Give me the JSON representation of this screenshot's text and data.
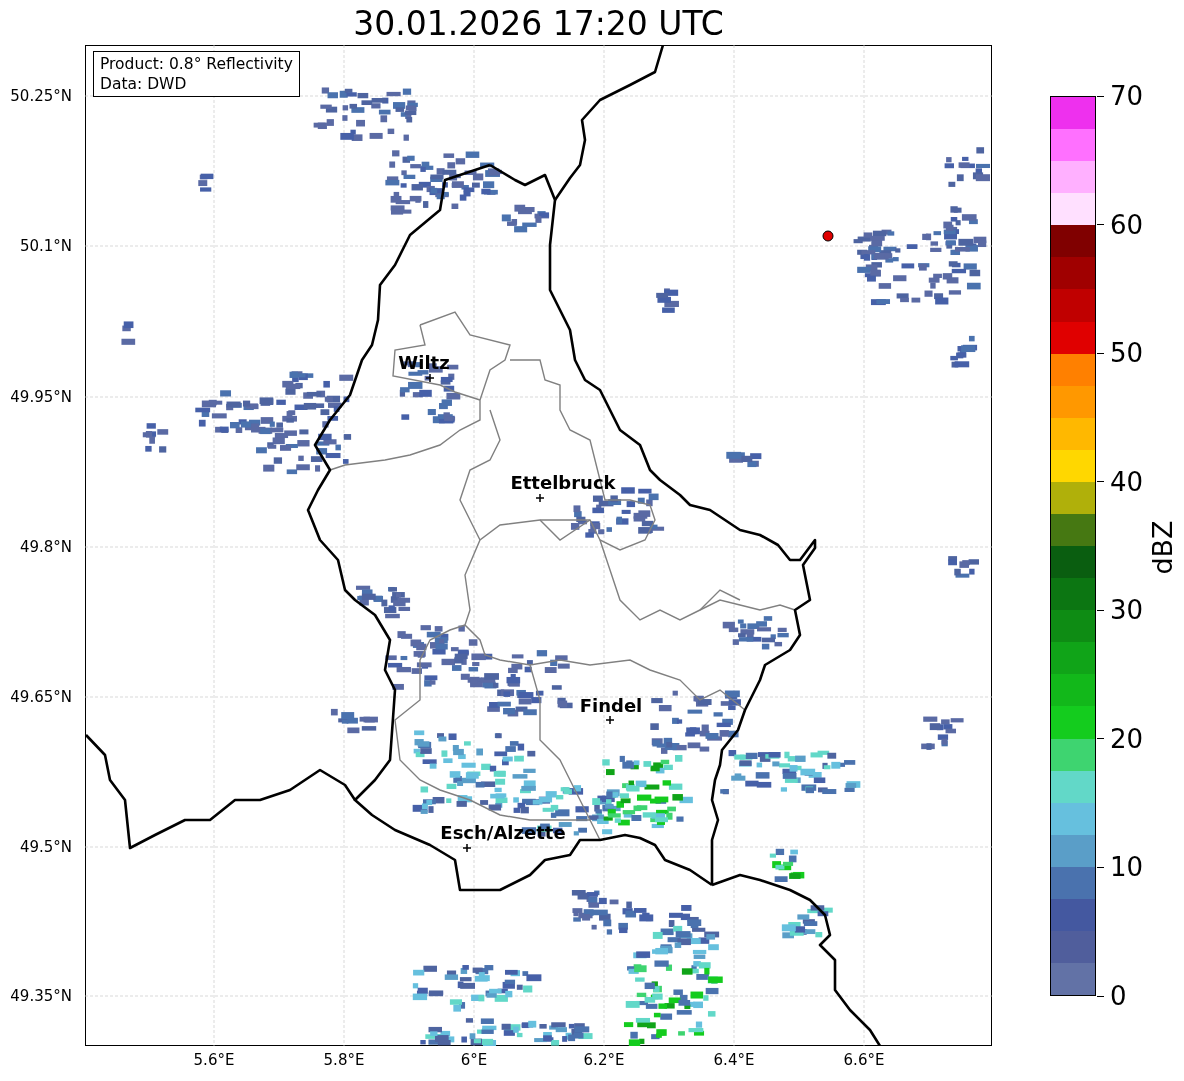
{
  "title": "30.01.2026 17:20 UTC",
  "map": {
    "info_box": [
      "Product: 0.8° Reflectivity",
      "Data: DWD"
    ],
    "places": [
      {
        "name": "Wiltz"
      },
      {
        "name": "Ettelbruck"
      },
      {
        "name": "Findel"
      },
      {
        "name": "Esch/Alzette"
      }
    ],
    "xticks": [
      "5.6°E",
      "5.8°E",
      "6°E",
      "6.2°E",
      "6.4°E",
      "6.6°E"
    ],
    "yticks": [
      "50.25°N",
      "50.1°N",
      "49.95°N",
      "49.8°N",
      "49.65°N",
      "49.5°N",
      "49.35°N"
    ]
  },
  "colorbar": {
    "label": "dBZ",
    "ticks": [
      "70",
      "60",
      "50",
      "40",
      "30",
      "20",
      "10",
      "0"
    ],
    "segments": [
      {
        "color": "#ee30ee"
      },
      {
        "color": "#ff70ff"
      },
      {
        "color": "#ffb0ff"
      },
      {
        "color": "#ffe0ff"
      },
      {
        "color": "#800000"
      },
      {
        "color": "#a00000"
      },
      {
        "color": "#c00000"
      },
      {
        "color": "#e00000"
      },
      {
        "color": "#ff8000"
      },
      {
        "color": "#ff9800"
      },
      {
        "color": "#ffb800"
      },
      {
        "color": "#ffd700"
      },
      {
        "color": "#b0b00a"
      },
      {
        "color": "#467812"
      },
      {
        "color": "#0a5e10"
      },
      {
        "color": "#0c7612"
      },
      {
        "color": "#0e8c14"
      },
      {
        "color": "#10a418"
      },
      {
        "color": "#12b81a"
      },
      {
        "color": "#14cc1e"
      },
      {
        "color": "#3ed470"
      },
      {
        "color": "#62d8c8"
      },
      {
        "color": "#66c0de"
      },
      {
        "color": "#5a9ec8"
      },
      {
        "color": "#4a72ae"
      },
      {
        "color": "#4458a0"
      },
      {
        "color": "#505e9c"
      },
      {
        "color": "#6272a6"
      }
    ]
  }
}
